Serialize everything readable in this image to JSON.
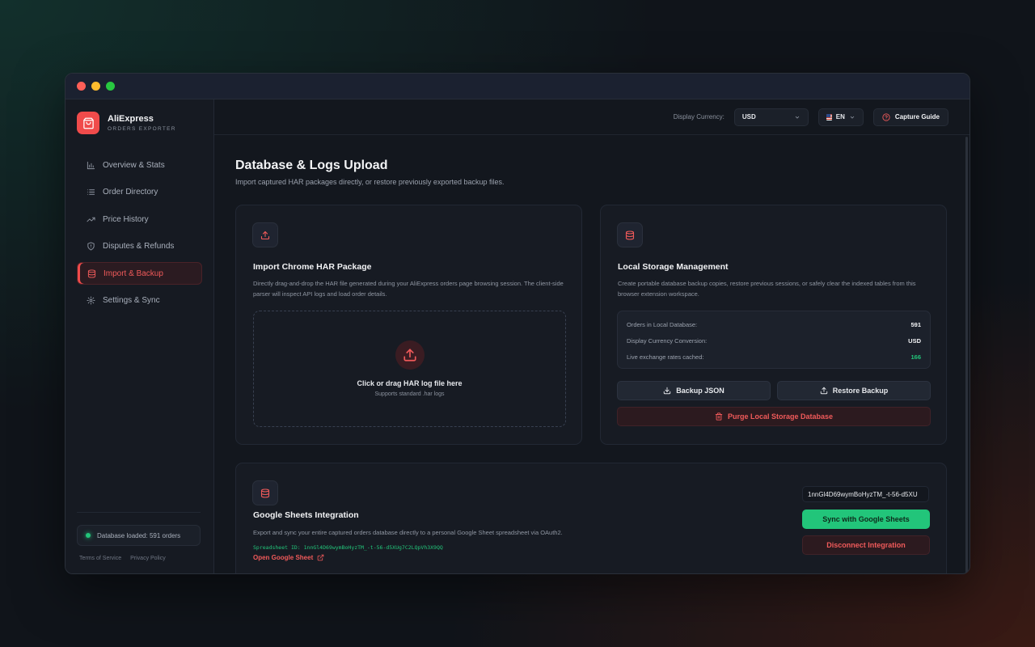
{
  "brand": {
    "name": "AliExpress",
    "subtitle": "ORDERS EXPORTER",
    "color": "#f04b4b"
  },
  "sidebar": {
    "items": [
      {
        "label": "Overview & Stats",
        "icon": "bar-chart-icon",
        "active": false
      },
      {
        "label": "Order Directory",
        "icon": "list-icon",
        "active": false
      },
      {
        "label": "Price History",
        "icon": "trend-icon",
        "active": false
      },
      {
        "label": "Disputes & Refunds",
        "icon": "shield-icon",
        "active": false
      },
      {
        "label": "Import & Backup",
        "icon": "database-icon",
        "active": true
      },
      {
        "label": "Settings & Sync",
        "icon": "gear-icon",
        "active": false
      }
    ],
    "status": "Database loaded: 591 orders",
    "footer": {
      "terms": "Terms of Service",
      "privacy": "Privacy Policy"
    }
  },
  "topbar": {
    "currency_label": "Display Currency:",
    "currency_value": "USD",
    "language_value": "EN",
    "guide_label": "Capture Guide"
  },
  "page": {
    "title": "Database & Logs Upload",
    "subtitle": "Import captured HAR packages directly, or restore previously exported backup files."
  },
  "import_card": {
    "title": "Import Chrome HAR Package",
    "description": "Directly drag-and-drop the HAR file generated during your AliExpress orders page browsing session. The client-side parser will inspect API logs and load order details.",
    "drop_title": "Click or drag HAR log file here",
    "drop_sub": "Supports standard .har logs"
  },
  "storage_card": {
    "title": "Local Storage Management",
    "description": "Create portable database backup copies, restore previous sessions, or safely clear the indexed tables from this browser extension workspace.",
    "stats": [
      {
        "label": "Orders in Local Database:",
        "value": "591"
      },
      {
        "label": "Display Currency Conversion:",
        "value": "USD"
      },
      {
        "label": "Live exchange rates cached:",
        "value": "166"
      }
    ],
    "backup_label": "Backup JSON",
    "restore_label": "Restore Backup",
    "purge_label": "Purge Local Storage Database"
  },
  "sheets_card": {
    "title": "Google Sheets Integration",
    "description": "Export and sync your entire captured orders database directly to a personal Google Sheet spreadsheet via OAuth2.",
    "sheet_id_text": "Spreadsheet ID: 1nnGl4D69wymBoHyzTM_-t-56-d5XUg7C2LQpVh3X9QQ",
    "open_link": "Open Google Sheet",
    "sheet_id_value": "1nnGl4D69wymBoHyzTM_-t-56-d5XU",
    "sync_label": "Sync with Google Sheets",
    "disconnect_label": "Disconnect Integration"
  },
  "colors": {
    "accent": "#f04b4b",
    "success": "#22c57a"
  }
}
